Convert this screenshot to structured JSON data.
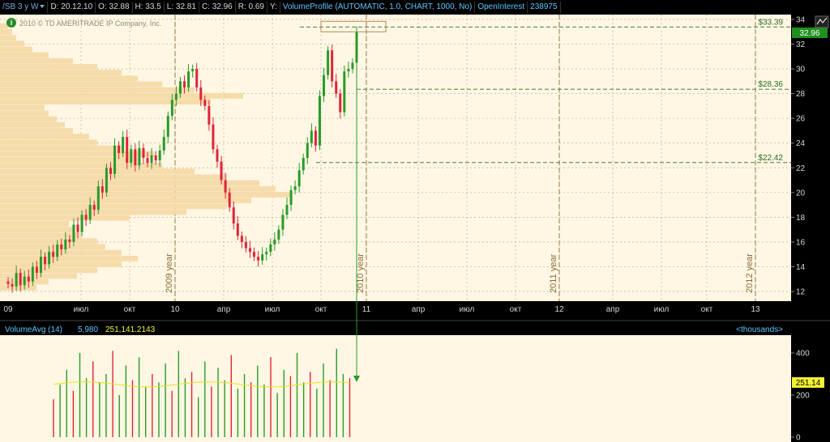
{
  "header": {
    "symbol": "/SB 3 y W",
    "date_label": "D: 20.12.10",
    "open_label": "O: 32.88",
    "high_label": "H: 33.5",
    "low_label": "L: 32.81",
    "close_label": "C: 32.96",
    "r_label": "R: 0.69",
    "y_label": "Y:",
    "study_label": "VolumeProfile (AUTOMATIC, 1.0, CHART, 1000, No)",
    "oi_label": "OpenInterest",
    "oi_value": "238975"
  },
  "chart_data": {
    "type": "candlestick",
    "copyright": "2010 © TD AMERITRADE IP Company, Inc.",
    "ylim": [
      11,
      34.5
    ],
    "y_ticks": [
      "12",
      "14",
      "16",
      "18",
      "20",
      "22",
      "24",
      "26",
      "28",
      "30",
      "32",
      "34"
    ],
    "x_ticks": [
      "09",
      "июл",
      "окт",
      "10",
      "апр",
      "июл",
      "окт",
      "11",
      "апр",
      "июл",
      "окт",
      "12",
      "апр",
      "июл",
      "окт",
      "13"
    ],
    "year_labels": [
      "2009 year",
      "2010 year",
      "2011 year",
      "2012 year"
    ],
    "last_price": "32.96",
    "levels": [
      {
        "value": 33.39,
        "label": "$33.39"
      },
      {
        "value": 28.36,
        "label": "$28.36"
      },
      {
        "value": 22.42,
        "label": "$22.42"
      }
    ],
    "candles_close": [
      12.6,
      12.4,
      13.5,
      12.5,
      13.2,
      12.8,
      14.0,
      13.5,
      14.8,
      14.2,
      15.2,
      14.8,
      15.8,
      15.4,
      16.2,
      16.0,
      17.4,
      16.8,
      18.2,
      17.8,
      19.0,
      18.6,
      20.5,
      20.0,
      22.0,
      21.5,
      23.8,
      23.2,
      24.5,
      22.4,
      23.5,
      22.2,
      23.6,
      22.8,
      22.4,
      23.0,
      22.6,
      23.4,
      24.5,
      26.2,
      27.5,
      28.0,
      29.0,
      28.5,
      29.8,
      30.0,
      28.5,
      27.5,
      27.0,
      25.5,
      23.5,
      22.5,
      21.0,
      20.0,
      18.8,
      17.5,
      16.5,
      16.0,
      15.5,
      15.2,
      14.8,
      14.5,
      15.0,
      15.2,
      15.8,
      16.2,
      17.0,
      18.2,
      19.0,
      20.2,
      20.5,
      21.8,
      22.8,
      24.0,
      25.0,
      23.8,
      27.8,
      29.5,
      31.5,
      29.0,
      28.0,
      26.5,
      29.8,
      30.0,
      30.5,
      32.96
    ],
    "volume_profile_label_ticks": [
      "0",
      "200",
      "400"
    ]
  },
  "volume_panel": {
    "label": "VolumeAvg (14)",
    "value1": "5,980",
    "value2": "251,141.2143",
    "units": "<thousands>",
    "last_value": "251.14",
    "ticks": [
      "400",
      "200",
      "0"
    ]
  }
}
